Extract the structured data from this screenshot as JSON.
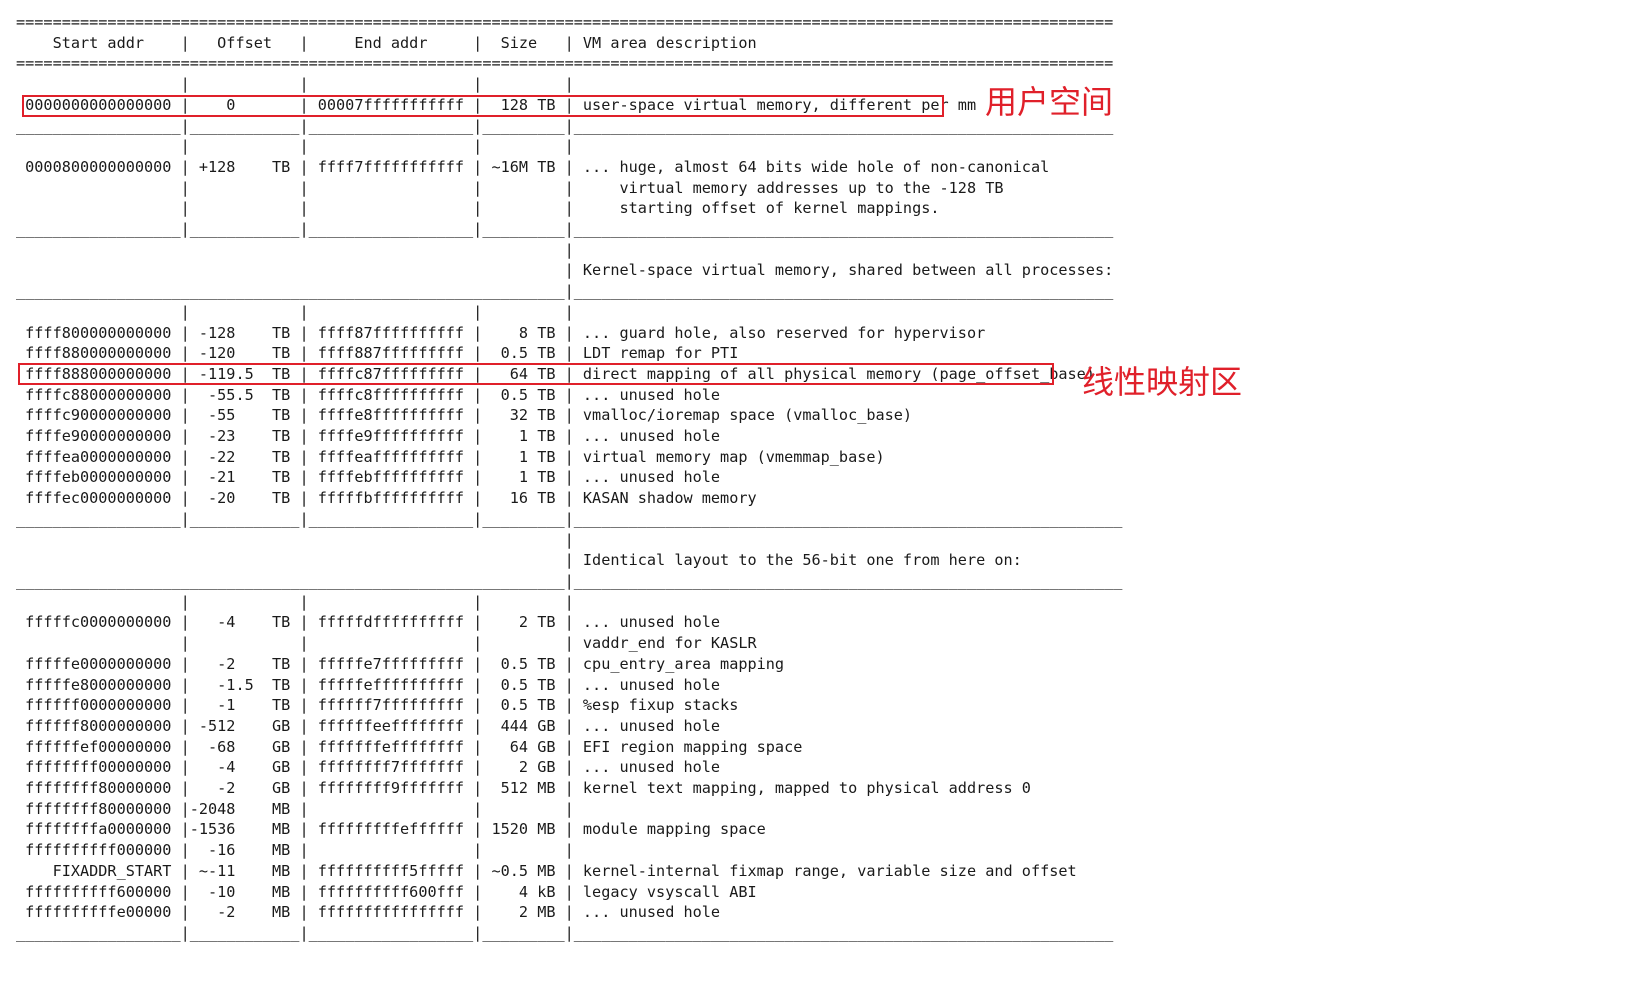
{
  "table_text": "========================================================================================================================\n    Start addr    |   Offset   |     End addr     |  Size   | VM area description\n========================================================================================================================\n                  |            |                  |         |\n 0000000000000000 |    0       | 00007fffffffffff |  128 TB | user-space virtual memory, different per mm\n__________________|____________|__________________|_________|___________________________________________________________\n                  |            |                  |         |\n 0000800000000000 | +128    TB | ffff7fffffffffff | ~16M TB | ... huge, almost 64 bits wide hole of non-canonical\n                  |            |                  |         |     virtual memory addresses up to the -128 TB\n                  |            |                  |         |     starting offset of kernel mappings.\n__________________|____________|__________________|_________|___________________________________________________________\n                                                            |\n                                                            | Kernel-space virtual memory, shared between all processes:\n____________________________________________________________|___________________________________________________________\n                  |            |                  |         |\n ffff800000000000 | -128    TB | ffff87ffffffffff |    8 TB | ... guard hole, also reserved for hypervisor\n ffff880000000000 | -120    TB | ffff887fffffffff |  0.5 TB | LDT remap for PTI\n ffff888000000000 | -119.5  TB | ffffc87fffffffff |   64 TB | direct mapping of all physical memory (page_offset_base)\n ffffc88000000000 |  -55.5  TB | ffffc8ffffffffff |  0.5 TB | ... unused hole\n ffffc90000000000 |  -55    TB | ffffe8ffffffffff |   32 TB | vmalloc/ioremap space (vmalloc_base)\n ffffe90000000000 |  -23    TB | ffffe9ffffffffff |    1 TB | ... unused hole\n ffffea0000000000 |  -22    TB | ffffeaffffffffff |    1 TB | virtual memory map (vmemmap_base)\n ffffeb0000000000 |  -21    TB | ffffebffffffffff |    1 TB | ... unused hole\n ffffec0000000000 |  -20    TB | fffffbffffffffff |   16 TB | KASAN shadow memory\n__________________|____________|__________________|_________|____________________________________________________________\n                                                            |\n                                                            | Identical layout to the 56-bit one from here on:\n____________________________________________________________|____________________________________________________________\n                  |            |                  |         |\n fffffc0000000000 |   -4    TB | fffffdffffffffff |    2 TB | ... unused hole\n                  |            |                  |         | vaddr_end for KASLR\n fffffe0000000000 |   -2    TB | fffffe7fffffffff |  0.5 TB | cpu_entry_area mapping\n fffffe8000000000 |   -1.5  TB | fffffeffffffffff |  0.5 TB | ... unused hole\n ffffff0000000000 |   -1    TB | ffffff7fffffffff |  0.5 TB | %esp fixup stacks\n ffffff8000000000 | -512    GB | ffffffeeffffffff |  444 GB | ... unused hole\n ffffffef00000000 |  -68    GB | fffffffeffffffff |   64 GB | EFI region mapping space\n ffffffff00000000 |   -4    GB | ffffffff7fffffff |    2 GB | ... unused hole\n ffffffff80000000 |   -2    GB | ffffffff9fffffff |  512 MB | kernel text mapping, mapped to physical address 0\n ffffffff80000000 |-2048    MB |                  |         |\n ffffffffa0000000 |-1536    MB | fffffffffeffffff | 1520 MB | module mapping space\n ffffffffff000000 |  -16    MB |                  |         |\n    FIXADDR_START | ~-11    MB | ffffffffff5fffff | ~0.5 MB | kernel-internal fixmap range, variable size and offset\n ffffffffff600000 |  -10    MB | ffffffffff600fff |    4 kB | legacy vsyscall ABI\n ffffffffffe00000 |   -2    MB | ffffffffffffffff |    2 MB | ... unused hole\n__________________|____________|__________________|_________|___________________________________________________________",
  "annotations": {
    "user_space": "用户空间",
    "linear_mapping": "线性映射区"
  },
  "colors": {
    "highlight": "#e0202a",
    "text": "#1a1a1a",
    "background": "#ffffff"
  }
}
